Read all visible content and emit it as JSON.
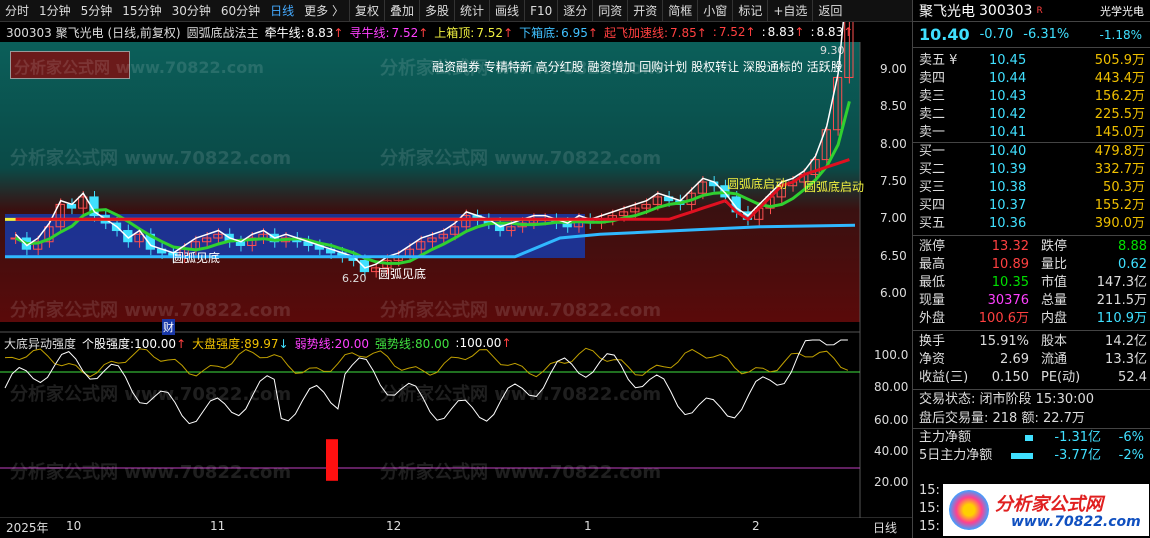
{
  "toolbar": {
    "items": [
      "分时",
      "1分钟",
      "5分钟",
      "15分钟",
      "30分钟",
      "60分钟",
      "日线",
      "更多 〉",
      "复权",
      "叠加",
      "多股",
      "统计",
      "画线",
      "F10",
      "逐分",
      "同资",
      "开资",
      "简框",
      "小窗",
      "标记",
      "+自选",
      "返回"
    ],
    "active": "日线"
  },
  "info": {
    "code_name": "300303 聚飞光电 (日线,前复权)",
    "indicator": "圆弧底战法主",
    "items": [
      {
        "label": "牵牛线:",
        "value": "8.83",
        "arrow": "↑",
        "color": "#ffffff"
      },
      {
        "label": "寻牛线:",
        "value": "7.52",
        "arrow": "↑",
        "color": "#ff40ff"
      },
      {
        "label": "上箱顶:",
        "value": "7.52",
        "arrow": "↑",
        "color": "#f0f040"
      },
      {
        "label": "下箱底:",
        "value": "6.95",
        "arrow": "↑",
        "color": "#40c0ff"
      },
      {
        "label": "起飞加速线:",
        "value": "7.85",
        "arrow": "↑",
        "color": "#ff4040"
      },
      {
        "label": ":",
        "value": "7.52",
        "arrow": "↑",
        "color": "#ff4040"
      },
      {
        "label": ":",
        "value": "8.83",
        "arrow": "↑",
        "color": "#ffffff"
      },
      {
        "label": ":",
        "value": "8.83",
        "arrow": "↑",
        "color": "#ffffff"
      }
    ]
  },
  "tags": "融资融券 专精特新 高分红股 融资增加 回购计划 股权转让 深股通标的 活跃股",
  "annotations": {
    "arc1": "圆弧见底",
    "arc2": "圆弧见底",
    "start1": "圆弧底启动",
    "start2": "圆弧底启动",
    "low": "6.20",
    "high": "9.30",
    "cai": "财"
  },
  "watermark": "分析家公式网 www.70822.com",
  "price_axis": [
    "9.00",
    "8.50",
    "8.00",
    "7.50",
    "7.00",
    "6.50",
    "6.00"
  ],
  "sub": {
    "title": "大底异动强度",
    "items": [
      {
        "label": "个股强度:",
        "value": "100.00",
        "arrow": "↑",
        "color": "#ffffff"
      },
      {
        "label": "大盘强度:",
        "value": "89.97",
        "arrow": "↓",
        "color": "#f0c000"
      },
      {
        "label": "弱势线:",
        "value": "20.00",
        "arrow": "",
        "color": "#ff40ff"
      },
      {
        "label": "强势线:",
        "value": "80.00",
        "arrow": "",
        "color": "#40e040"
      },
      {
        "label": ":",
        "value": "100.00",
        "arrow": "↑",
        "color": "#ffffff"
      }
    ],
    "axis": [
      "100.0",
      "80.00",
      "60.00",
      "40.00",
      "20.00"
    ]
  },
  "xaxis": [
    "2025年",
    "10",
    "11",
    "12",
    "1",
    "2"
  ],
  "period": "日线",
  "stock": {
    "name": "聚飞光电",
    "code": "300303",
    "flag": "R",
    "badge": "光学光电",
    "price": "10.40",
    "change": "-0.70",
    "pct": "-6.31%",
    "badge_pct": "-1.18%"
  },
  "asks": [
    {
      "label": "卖五 ¥",
      "price": "10.45",
      "vol": "505.9万"
    },
    {
      "label": "卖四",
      "price": "10.44",
      "vol": "443.4万"
    },
    {
      "label": "卖三",
      "price": "10.43",
      "vol": "156.2万"
    },
    {
      "label": "卖二",
      "price": "10.42",
      "vol": "225.5万"
    },
    {
      "label": "卖一",
      "price": "10.41",
      "vol": "145.0万"
    }
  ],
  "bids": [
    {
      "label": "买一",
      "price": "10.40",
      "vol": "479.8万"
    },
    {
      "label": "买二",
      "price": "10.39",
      "vol": "332.7万"
    },
    {
      "label": "买三",
      "price": "10.38",
      "vol": "50.3万"
    },
    {
      "label": "买四",
      "price": "10.37",
      "vol": "155.2万"
    },
    {
      "label": "买五",
      "price": "10.36",
      "vol": "390.0万"
    }
  ],
  "stats": [
    {
      "l1": "涨停",
      "v1": "13.32",
      "c1": "#ff4040",
      "l2": "跌停",
      "v2": "8.88",
      "c2": "#00e000"
    },
    {
      "l1": "最高",
      "v1": "10.89",
      "c1": "#ff4040",
      "l2": "量比",
      "v2": "0.62",
      "c2": "#40e0ff"
    },
    {
      "l1": "最低",
      "v1": "10.35",
      "c1": "#00e000",
      "l2": "市值",
      "v2": "147.3亿",
      "c2": "#ddd"
    },
    {
      "l1": "现量",
      "v1": "30376",
      "c1": "#ff40ff",
      "l2": "总量",
      "v2": "211.5万",
      "c2": "#ddd"
    },
    {
      "l1": "外盘",
      "v1": "100.6万",
      "c1": "#ff4040",
      "l2": "内盘",
      "v2": "110.9万",
      "c2": "#40e0ff"
    }
  ],
  "stats2": [
    {
      "l1": "换手",
      "v1": "15.91%",
      "l2": "股本",
      "v2": "14.2亿"
    },
    {
      "l1": "净资",
      "v1": "2.69",
      "l2": "流通",
      "v2": "13.3亿"
    },
    {
      "l1": "收益(三)",
      "v1": "0.150",
      "l2": "PE(动)",
      "v2": "52.4"
    }
  ],
  "trade": {
    "status": "交易状态: 闭市阶段 15:30:00",
    "after": "盘后交易量: 218  额: 22.7万"
  },
  "flow": [
    {
      "label": "主力净额",
      "value": "-1.31亿",
      "pct": "-6%"
    },
    {
      "label": "5日主力净额",
      "value": "-3.77亿",
      "pct": "-2%"
    }
  ],
  "bottom_clock": [
    "15:",
    "15:",
    "15:"
  ],
  "logo": {
    "text": "分析家公式网",
    "url": "www.70822.com"
  }
}
